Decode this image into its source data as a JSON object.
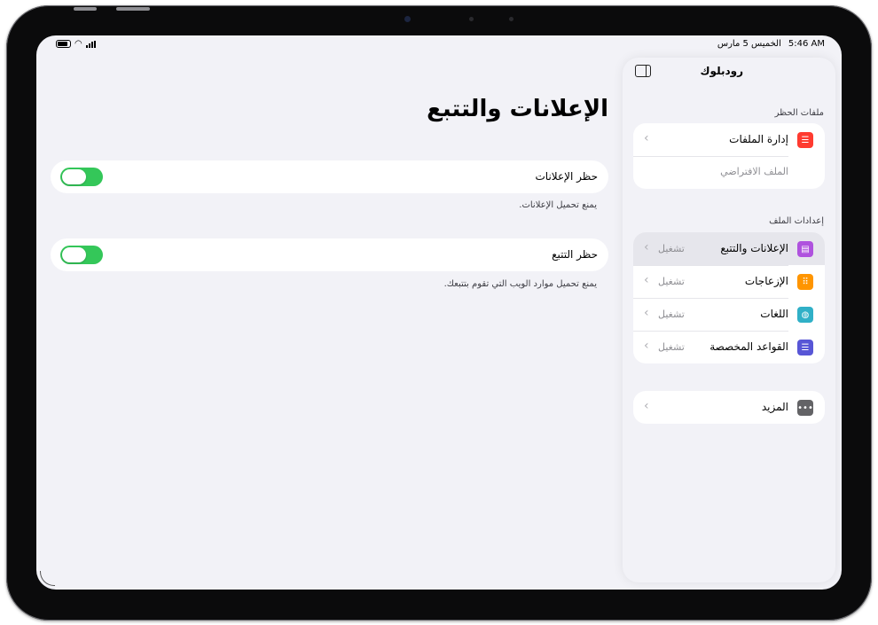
{
  "status_bar": {
    "time": "5:46 AM",
    "date": "الخميس 5 مارس"
  },
  "main": {
    "title": "الإعلانات والتتبع",
    "settings": [
      {
        "label": "حظر الإعلانات",
        "footnote": "يمنع تحميل الإعلانات.",
        "enabled": true
      },
      {
        "label": "حظر التتبع",
        "footnote": "يمنع تحميل موارد الويب التي تقوم بتتبعك.",
        "enabled": true
      }
    ]
  },
  "sidebar": {
    "title": "رودبلوك",
    "block_files_header": "ملفات الحظر",
    "manage_files": "إدارة الملفات",
    "default_file": "الملف الافتراضي",
    "file_settings_header": "إعدادات الملف",
    "items": [
      {
        "label": "الإعلانات والتتبع",
        "status": "تشغيل",
        "icon": "ads-tracking-icon",
        "color": "#af52de"
      },
      {
        "label": "الإزعاجات",
        "status": "تشغيل",
        "icon": "annoyances-icon",
        "color": "#ff9500"
      },
      {
        "label": "اللغات",
        "status": "تشغيل",
        "icon": "languages-globe-icon",
        "color": "#30b0c7"
      },
      {
        "label": "القواعد المخصصة",
        "status": "تشغيل",
        "icon": "custom-rules-icon",
        "color": "#5856d6"
      }
    ],
    "more": "المزيد",
    "manage_icon_color": "#ff3b30",
    "more_icon_color": "#636366"
  }
}
